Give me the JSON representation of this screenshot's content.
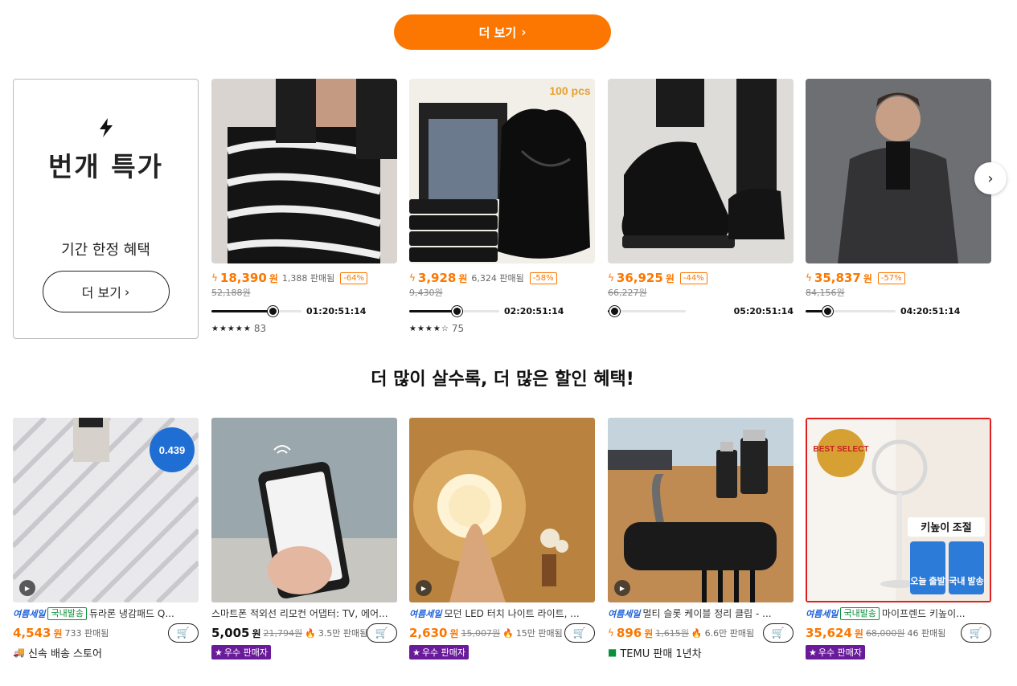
{
  "top_more_button": {
    "label": "더 보기",
    "chevron": "›"
  },
  "flash": {
    "icon": "lightning-icon",
    "title": "번개 특가",
    "subtitle": "기간 한정 혜택",
    "button_label": "더 보기",
    "chevron": "›"
  },
  "deals": [
    {
      "price": "18,390",
      "won": "원",
      "sold": "1,388 판매됨",
      "discount": "-64%",
      "original": "52,188원",
      "countdown": "01:20:51:14",
      "progress": 0.68,
      "stars": "★★★★★",
      "reviews": "83",
      "image": "striped-sweater"
    },
    {
      "price": "3,928",
      "won": "원",
      "sold": "6,324 판매됨",
      "discount": "-58%",
      "original": "9,430원",
      "countdown": "02:20:51:14",
      "progress": 0.53,
      "stars": "★★★★☆",
      "reviews": "75",
      "image": "trash-bags",
      "image_text": "100 pcs"
    },
    {
      "price": "36,925",
      "won": "원",
      "sold": "",
      "discount": "-44%",
      "original": "66,227원",
      "countdown": "05:20:51:14",
      "progress": 0.08,
      "stars": "",
      "reviews": "",
      "image": "leather-shoes"
    },
    {
      "price": "35,837",
      "won": "원",
      "sold": "",
      "discount": "-57%",
      "original": "84,156원",
      "countdown": "04:20:51:14",
      "progress": 0.24,
      "stars": "",
      "reviews": "",
      "image": "man-coat"
    }
  ],
  "carousel_next": "›",
  "section_title": "더 많이 살수록, 더 많은 할인 혜택!",
  "products": [
    {
      "summer": "여름세일",
      "domestic": "국내발송",
      "title": "듀라론 냉감패드 Q...",
      "price": "4,543",
      "won": "원",
      "original": "",
      "sold": "733 판매됨",
      "flame": false,
      "badge": "",
      "store": "신속 배송 스토어",
      "price_color": "orange",
      "video": true,
      "image_text": "0.439"
    },
    {
      "summer": "",
      "domestic": "",
      "title": "스마트폰 적외선 리모컨 어댑터: TV, 에어...",
      "price": "5,005",
      "won": "원",
      "original": "21,794원",
      "sold": "3.5만 판매됨",
      "flame": true,
      "badge": "우수 판매자",
      "store": "",
      "price_color": "black",
      "video": false,
      "image_text": ""
    },
    {
      "summer": "여름세일",
      "domestic": "",
      "title": "모던 LED 터치 나이트 라이트, ...",
      "price": "2,630",
      "won": "원",
      "original": "15,007원",
      "sold": "15만 판매됨",
      "flame": true,
      "badge": "우수 판매자",
      "store": "",
      "price_color": "orange",
      "video": true,
      "image_text": ""
    },
    {
      "summer": "여름세일",
      "domestic": "",
      "title": "멀티 슬롯 케이블 정리 클립 - ...",
      "price": "896",
      "won": "원",
      "original": "1,615원",
      "sold": "6.6만 판매됨",
      "flame": true,
      "badge": "",
      "store": "TEMU 판매 1년차",
      "price_color": "orange",
      "video": true,
      "bolt": true,
      "image_text": ""
    },
    {
      "summer": "여름세일",
      "domestic": "국내발송",
      "title": "마이프렌드 키높이...",
      "price": "35,624",
      "won": "원",
      "original": "68,000원",
      "sold": "46 판매됨",
      "flame": false,
      "badge": "우수 판매자",
      "store": "",
      "price_color": "orange",
      "video": false,
      "image_text": "키높이 조절",
      "image_text2": "오늘 출발",
      "image_text3": "국내 발송",
      "image_text4": "BEST SELECT"
    }
  ]
}
